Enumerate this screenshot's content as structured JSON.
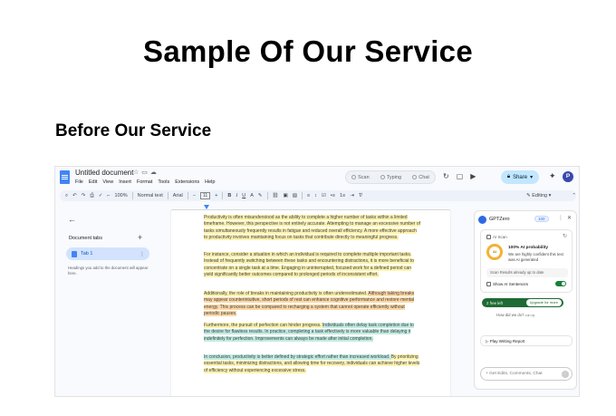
{
  "heading": {
    "title": "Sample Of Our Service",
    "subtitle": "Before Our Service"
  },
  "docs": {
    "doc_title": "Untitled document",
    "menu": [
      "File",
      "Edit",
      "View",
      "Insert",
      "Format",
      "Tools",
      "Extensions",
      "Help"
    ],
    "modes": [
      "Scan",
      "Typing",
      "Chat"
    ],
    "share_label": "Share",
    "avatar_letter": "P",
    "toolbar": {
      "zoom": "100%",
      "style": "Normal text",
      "font": "Arial",
      "font_size": "11",
      "mode": "Editing"
    },
    "sidebar": {
      "section": "Document tabs",
      "tab": "Tab 1",
      "help": "Headings you add to the document will appear here."
    },
    "paragraphs": [
      {
        "segments": [
          {
            "text": "Productivity is often misunderstood as the ability to complete a higher number of tasks within a limited timeframe. However, this perspective is not entirely accurate. Attempting to manage an excessive number of tasks simultaneously frequently results in fatigue and reduced overall efficiency. A more effective approach to productivity involves maintaining focus on tasks that contribute directly to meaningful progress.",
            "hl": "yellow"
          }
        ]
      },
      {
        "segments": [
          {
            "text": "For instance, consider a situation in which an individual is required to complete multiple important tasks. Instead of frequently switching between these tasks and encountering distractions, it is more beneficial to concentrate on a single task at a time. Engaging in uninterrupted, focused work for a defined period can yield significantly better outcomes compared to prolonged periods of inconsistent effort.",
            "hl": "yellow"
          }
        ]
      },
      {
        "segments": [
          {
            "text": "Additionally, the role of breaks in maintaining productivity is often underestimated. ",
            "hl": "yellow"
          },
          {
            "text": "Although taking breaks may appear counterintuitive, short periods of rest can enhance cognitive performance and restore mental energy. This process can be compared to recharging a system that cannot operate efficiently without periodic pauses.",
            "hl": "orange"
          }
        ]
      },
      {
        "segments": [
          {
            "text": "Furthermore, the pursuit of perfection can hinder progress. ",
            "hl": "yellow"
          },
          {
            "text": "Individuals often delay task completion due to the desire for flawless results. In practice, completing a task effectively is more valuable than delaying it indefinitely for perfection. Improvements can always be made after initial completion.",
            "hl": "teal"
          }
        ]
      },
      {
        "segments": [
          {
            "text": "In conclusion, productivity is better defined by strategic effort rather than increased workload. ",
            "hl": "teal"
          },
          {
            "text": "By prioritizing essential tasks, minimizing distractions, and allowing time for recovery, individuals can achieve higher levels of efficiency without experiencing excessive stress.",
            "hl": "yellow"
          }
        ]
      }
    ],
    "highlight_colors": {
      "yellow": "#fff3b0",
      "orange": "#ffd9a6",
      "teal": "#c3ebe2"
    }
  },
  "gptzero": {
    "name": "GPTZero",
    "badge": "100",
    "scan_label": "AI Scan",
    "probability_value": "AI",
    "probability": "100% AI probability",
    "probability_desc": "We are highly confident this text was AI generated",
    "scan_results": "Scan  Results already up to date",
    "show_sentences": "Show AI Sentences",
    "free_left": "2 free left",
    "upgrade": "Upgrade for more",
    "how_did": "How did we do?",
    "play_report": "Play Writing Report",
    "chat_placeholder": "Get Edits, Comments, Chat"
  }
}
